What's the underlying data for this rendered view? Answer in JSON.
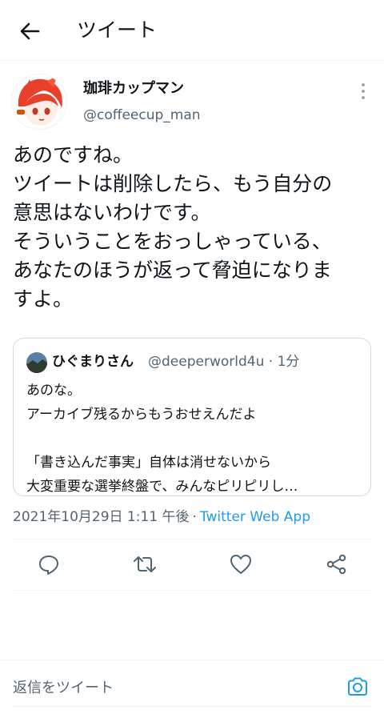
{
  "header": {
    "title": "ツイート"
  },
  "tweet": {
    "author": {
      "display_name": "珈琲カップマン",
      "handle": "@coffeecup_man"
    },
    "text_lines": [
      "あのですね。",
      "ツイートは削除したら、もう自分の",
      "意思はないわけです。",
      "そういうことをおっしゃっている、",
      "あなたのほうが返って脅迫になりま",
      "すよ。"
    ],
    "quoted": {
      "display_name": "ひぐまりさん",
      "handle": "@deeperworld4u",
      "time": "1分",
      "text_lines": [
        "あのな。",
        "アーカイブ残るからもうおせえんだよ",
        "",
        "「書き込んだ事実」自体は消せないから",
        "大変重要な選挙終盤で、みんなピリピリし…"
      ]
    },
    "timestamp": "2021年10月29日 1:11 午後",
    "separator": "·",
    "source": "Twitter Web App"
  },
  "actions": {
    "icons": [
      "reply-icon",
      "retweet-icon",
      "like-icon",
      "share-icon"
    ]
  },
  "reply_bar": {
    "placeholder": "返信をツイート"
  },
  "colors": {
    "accent": "#1d9bf0",
    "muted": "#536471",
    "border": "#cfd9de"
  }
}
